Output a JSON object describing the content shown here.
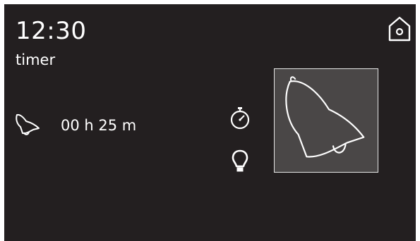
{
  "header": {
    "time": "12:30",
    "mode": "timer"
  },
  "timer": {
    "icon": "bell-icon",
    "value": "00 h 25 m"
  },
  "icons": {
    "home": "home-icon",
    "stopwatch": "stopwatch-icon",
    "light": "light-bulb-icon",
    "selected": "bell-icon"
  },
  "colors": {
    "background": "#231f20",
    "foreground": "#ffffff",
    "selected_tile": "#4a4747"
  }
}
